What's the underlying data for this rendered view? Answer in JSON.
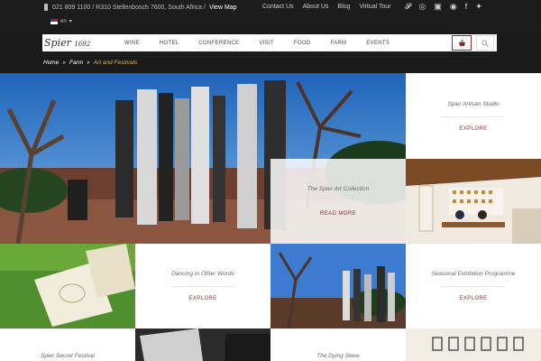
{
  "topbar": {
    "contact_text": "021 809 1100 / R310 Stellenbosch 7600, South Africa /",
    "view_map": "View Map",
    "language": "en",
    "links": [
      "Contact Us",
      "About Us",
      "Blog",
      "Virtual Tour"
    ],
    "social_icons": [
      "pinterest-icon",
      "tripadvisor-icon",
      "youtube-icon",
      "instagram-icon",
      "facebook-icon",
      "twitter-icon"
    ]
  },
  "header": {
    "logo_text": "Spier",
    "logo_year": "1692",
    "nav_items": [
      "WINE",
      "HOTEL",
      "CONFERENCE",
      "VISIT",
      "FOOD",
      "FARM",
      "EVENTS"
    ]
  },
  "breadcrumb": {
    "home": "Home",
    "sep1": "»",
    "farm": "Farm",
    "sep2": "»",
    "current": "Art and Festivals"
  },
  "tiles": {
    "artisan": {
      "title": "Spier Artisan Studio",
      "link": "EXPLORE"
    },
    "art_collection": {
      "title": "The Spier Art Collection",
      "link": "READ MORE"
    },
    "dancing": {
      "title": "Dancing In Other Words",
      "link": "EXPLORE"
    },
    "seasonal": {
      "title": "Seasonal Exhibition Programme",
      "link": "EXPLORE"
    },
    "secret_festival": {
      "title": "Spier Secret Festival"
    },
    "dying_slave": {
      "title": "The Dying Slave"
    }
  },
  "colors": {
    "accent": "#8b2a2a",
    "breadcrumb_current": "#d9b25f",
    "topbar": "#1c1c1c"
  }
}
